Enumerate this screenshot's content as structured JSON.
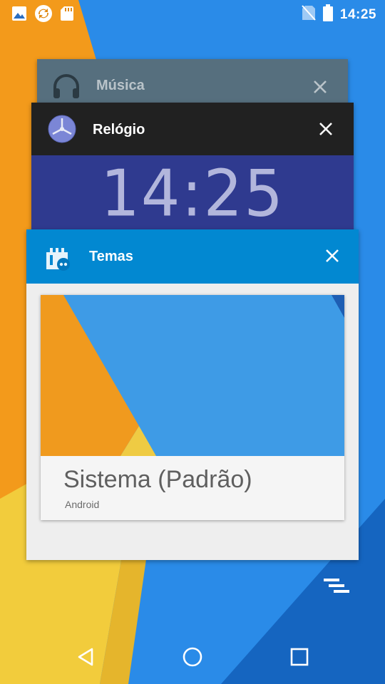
{
  "status_bar": {
    "time": "14:25",
    "left_icons": [
      "image-icon",
      "sync-icon",
      "sd-card-icon"
    ],
    "right_icons": [
      "no-sim-icon",
      "battery-icon"
    ]
  },
  "recents": [
    {
      "app": "Música",
      "icon": "headphones-icon",
      "header_color": "#566f7e"
    },
    {
      "app": "Relógio",
      "icon": "clock-app-icon",
      "header_color": "#212121",
      "preview_text": "14:25"
    },
    {
      "app": "Temas",
      "icon": "themes-app-icon",
      "header_color": "#0288d1",
      "preview": {
        "theme_name": "Sistema (Padrão)",
        "theme_author": "Android"
      }
    }
  ],
  "clear_all_icon": "clear-all-icon",
  "nav": {
    "back": "back-icon",
    "home": "home-icon",
    "recents": "recents-icon"
  },
  "colors": {
    "wallpaper_blue": "#2a8be8",
    "wallpaper_orange": "#f39a1b",
    "wallpaper_yellow": "#f2cc3c",
    "wallpaper_dark_blue": "#1565c0"
  }
}
